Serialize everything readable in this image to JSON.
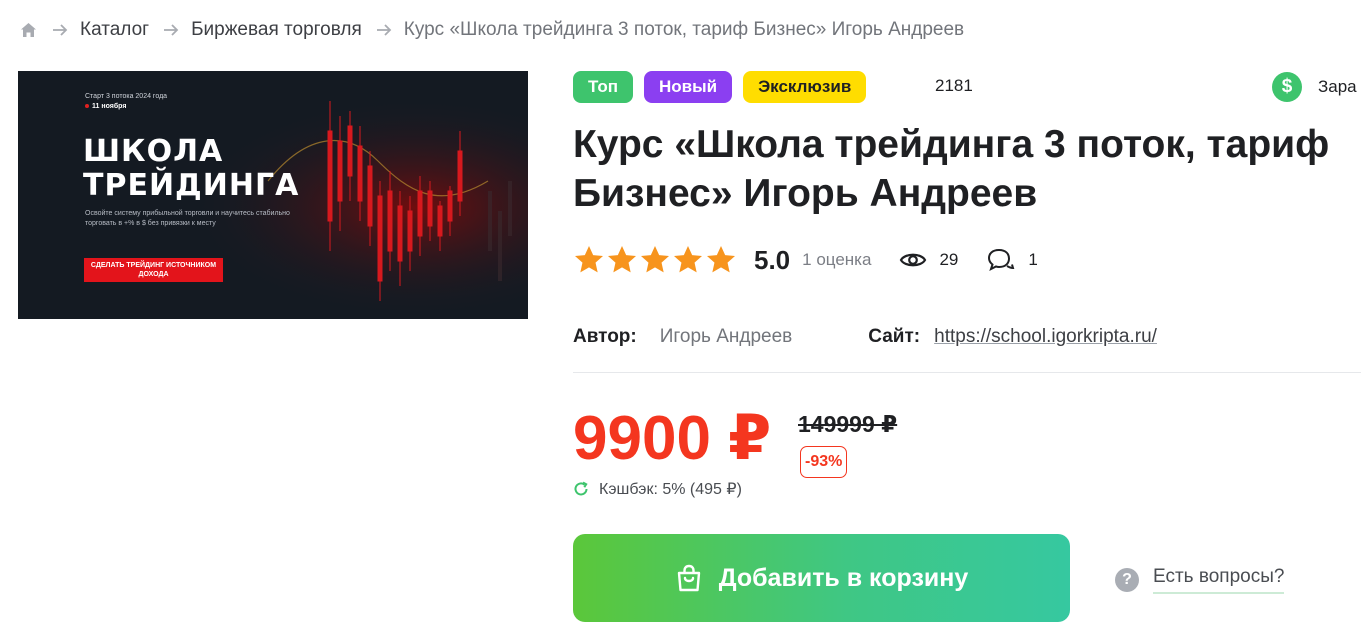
{
  "breadcrumb": {
    "home_icon": "home-icon",
    "items": [
      "Каталог",
      "Биржевая торговля"
    ],
    "current": "Курс «Школа трейдинга 3 поток, тариф Бизнес» Игорь Андреев"
  },
  "banner": {
    "start_text": "Старт 3 потока 2024 года",
    "date_text": "11 ноября",
    "title_line1": "ШКОЛА",
    "title_line2": "ТРЕЙДИНГА",
    "description": "Освойте систему прибыльной торговли и научитесь стабильно торговать в +% в $ без привязки к месту",
    "cta": "СДЕЛАТЬ ТРЕЙДИНГ ИСТОЧНИКОМ ДОХОДА"
  },
  "badges": {
    "top": "Топ",
    "new": "Новый",
    "exclusive": "Эксклюзив"
  },
  "top_count": "2181",
  "earn": {
    "icon": "dollar-icon",
    "label": "Зара"
  },
  "product": {
    "title": "Курс «Школа трейдинга 3 поток, тариф Бизнес» Игорь Андреев"
  },
  "rating": {
    "stars": 5,
    "value": "5.0",
    "count_label": "1 оценка",
    "views": "29",
    "comments": "1"
  },
  "meta": {
    "author_label": "Автор:",
    "author": "Игорь Андреев",
    "site_label": "Сайт:",
    "site": "https://school.igorkripta.ru/"
  },
  "price": {
    "current": "9900 ₽",
    "old": "149999 ₽",
    "discount": "-93%",
    "cashback": "Кэшбэк: 5% (495 ₽)"
  },
  "actions": {
    "add_to_cart": "Добавить в корзину",
    "questions": "Есть вопросы?"
  },
  "colors": {
    "accent_red": "#f4361f",
    "green": "#3ec46d",
    "purple": "#8b3ff1",
    "yellow": "#ffdd00",
    "star": "#f7941d"
  }
}
